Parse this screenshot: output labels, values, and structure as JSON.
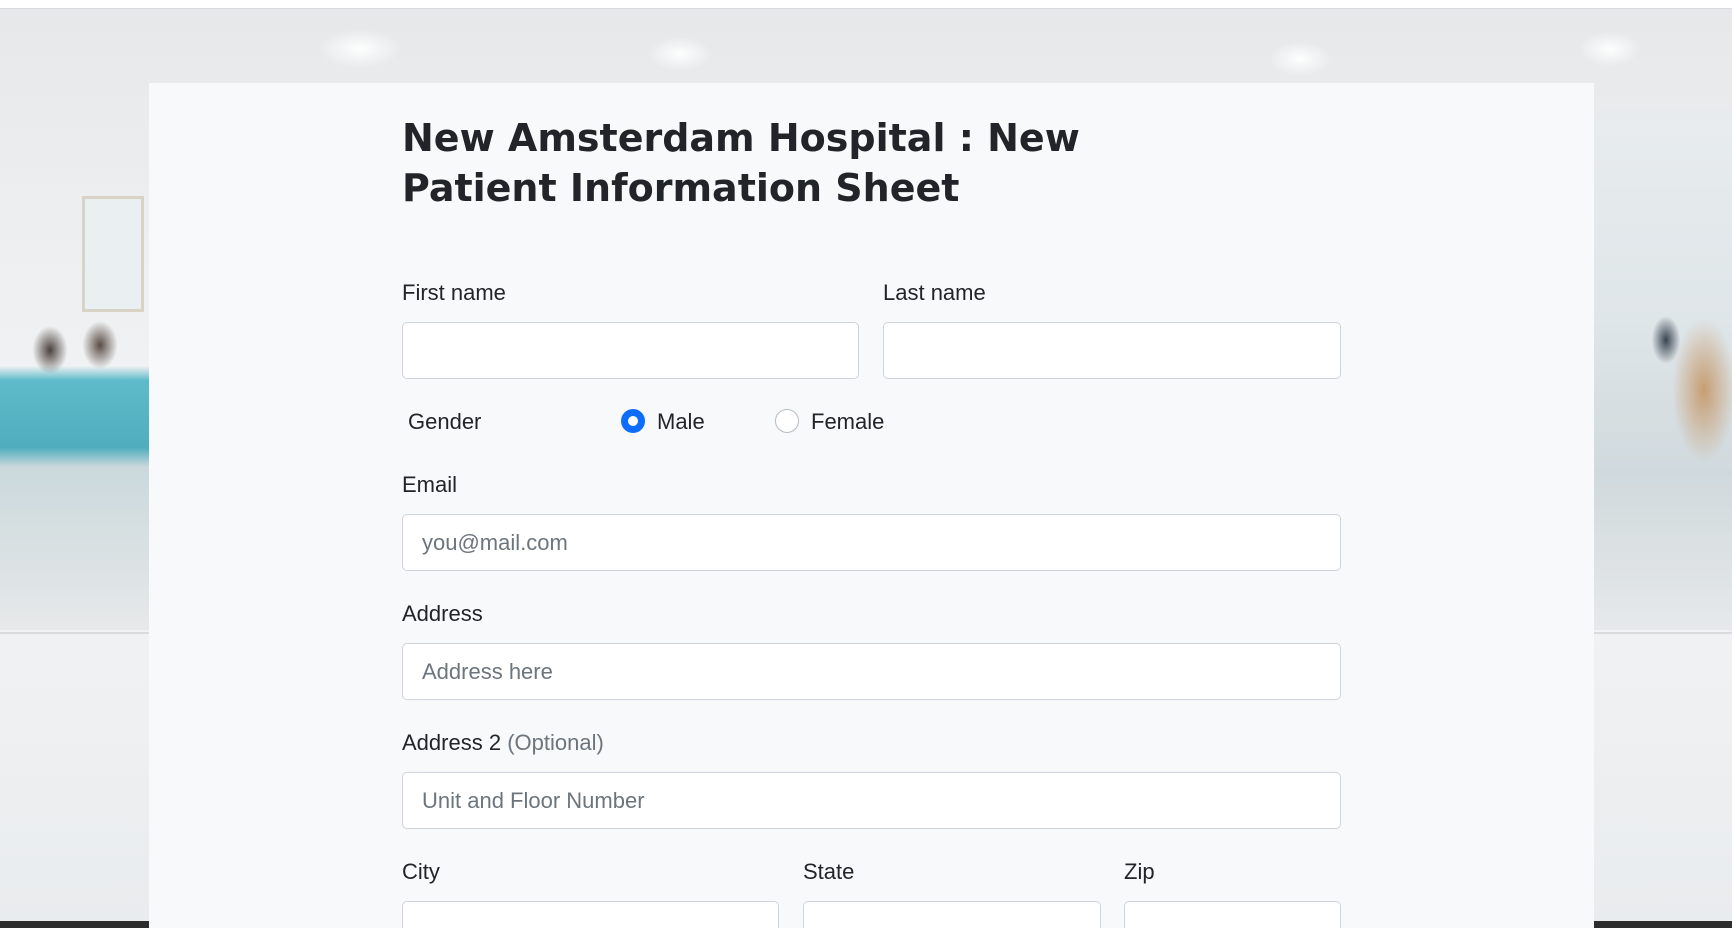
{
  "page": {
    "title": "New Amsterdam Hospital : New Patient Information Sheet"
  },
  "form": {
    "first_name": {
      "label": "First name",
      "value": ""
    },
    "last_name": {
      "label": "Last name",
      "value": ""
    },
    "gender": {
      "label": "Gender",
      "options": [
        {
          "label": "Male",
          "checked": true
        },
        {
          "label": "Female",
          "checked": false
        }
      ]
    },
    "email": {
      "label": "Email",
      "placeholder": "you@mail.com",
      "value": ""
    },
    "address": {
      "label": "Address",
      "placeholder": "Address here",
      "value": ""
    },
    "address2": {
      "label": "Address 2",
      "optional_note": "(Optional)",
      "placeholder": "Unit and Floor Number",
      "value": ""
    },
    "city": {
      "label": "City",
      "value": ""
    },
    "state": {
      "label": "State",
      "value": ""
    },
    "zip": {
      "label": "Zip",
      "value": ""
    }
  },
  "colors": {
    "accent": "#0d6efd",
    "panel_background": "#f8f9fa",
    "text": "#212529",
    "muted_text": "#6c757d",
    "input_border": "#ced4da"
  }
}
